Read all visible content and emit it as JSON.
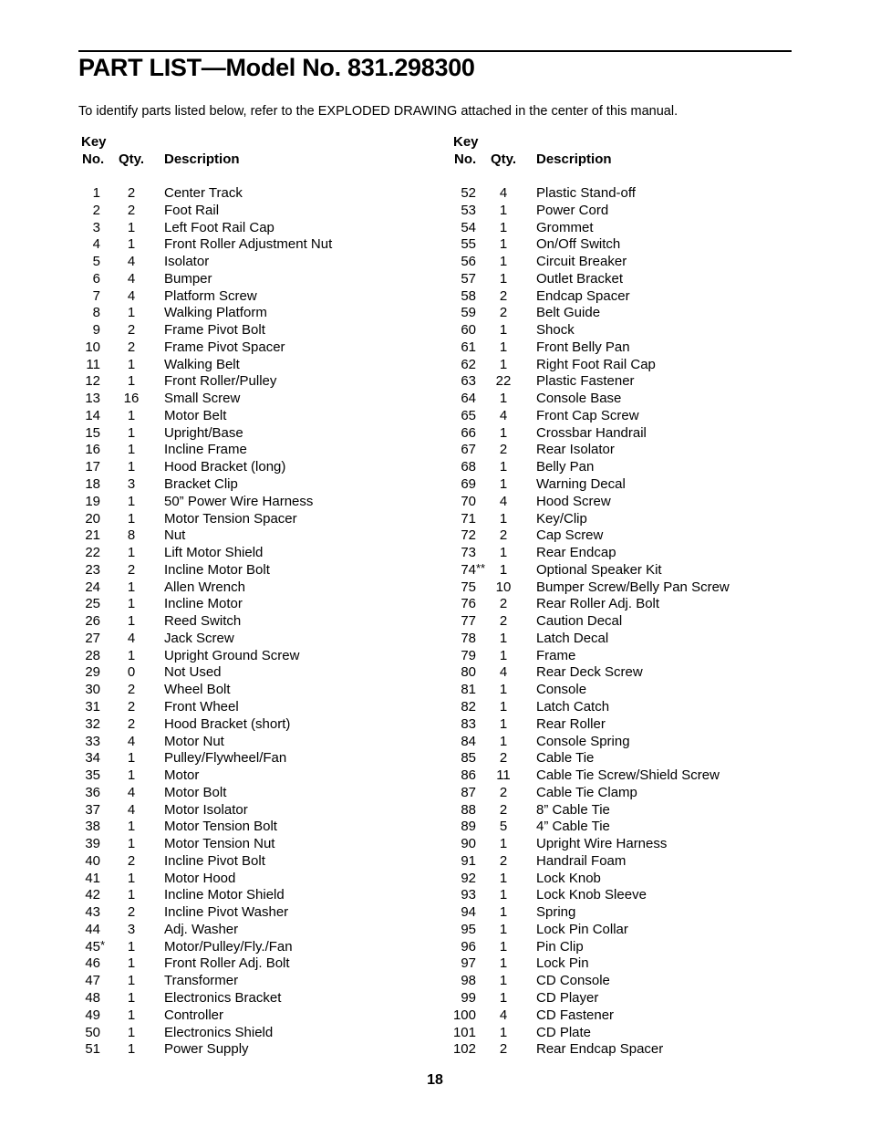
{
  "title": "PART LIST—Model No. 831.298300",
  "intro": "To identify parts listed below, refer to the EXPLODED DRAWING attached in the center of this manual.",
  "headers": {
    "key": "Key",
    "no": "No.",
    "qty": "Qty.",
    "description": "Description"
  },
  "left_parts": [
    {
      "key": "1",
      "mark": "",
      "qty": "2",
      "desc": "Center Track"
    },
    {
      "key": "2",
      "mark": "",
      "qty": "2",
      "desc": "Foot Rail"
    },
    {
      "key": "3",
      "mark": "",
      "qty": "1",
      "desc": "Left Foot Rail Cap"
    },
    {
      "key": "4",
      "mark": "",
      "qty": "1",
      "desc": "Front Roller Adjustment Nut"
    },
    {
      "key": "5",
      "mark": "",
      "qty": "4",
      "desc": "Isolator"
    },
    {
      "key": "6",
      "mark": "",
      "qty": "4",
      "desc": "Bumper"
    },
    {
      "key": "7",
      "mark": "",
      "qty": "4",
      "desc": "Platform Screw"
    },
    {
      "key": "8",
      "mark": "",
      "qty": "1",
      "desc": "Walking Platform"
    },
    {
      "key": "9",
      "mark": "",
      "qty": "2",
      "desc": "Frame Pivot Bolt"
    },
    {
      "key": "10",
      "mark": "",
      "qty": "2",
      "desc": "Frame Pivot Spacer"
    },
    {
      "key": "11",
      "mark": "",
      "qty": "1",
      "desc": "Walking Belt"
    },
    {
      "key": "12",
      "mark": "",
      "qty": "1",
      "desc": "Front Roller/Pulley"
    },
    {
      "key": "13",
      "mark": "",
      "qty": "16",
      "desc": "Small Screw"
    },
    {
      "key": "14",
      "mark": "",
      "qty": "1",
      "desc": "Motor Belt"
    },
    {
      "key": "15",
      "mark": "",
      "qty": "1",
      "desc": "Upright/Base"
    },
    {
      "key": "16",
      "mark": "",
      "qty": "1",
      "desc": "Incline Frame"
    },
    {
      "key": "17",
      "mark": "",
      "qty": "1",
      "desc": "Hood Bracket (long)"
    },
    {
      "key": "18",
      "mark": "",
      "qty": "3",
      "desc": "Bracket Clip"
    },
    {
      "key": "19",
      "mark": "",
      "qty": "1",
      "desc": "50” Power Wire Harness"
    },
    {
      "key": "20",
      "mark": "",
      "qty": "1",
      "desc": "Motor Tension Spacer"
    },
    {
      "key": "21",
      "mark": "",
      "qty": "8",
      "desc": "Nut"
    },
    {
      "key": "22",
      "mark": "",
      "qty": "1",
      "desc": "Lift Motor Shield"
    },
    {
      "key": "23",
      "mark": "",
      "qty": "2",
      "desc": "Incline Motor Bolt"
    },
    {
      "key": "24",
      "mark": "",
      "qty": "1",
      "desc": "Allen Wrench"
    },
    {
      "key": "25",
      "mark": "",
      "qty": "1",
      "desc": "Incline Motor"
    },
    {
      "key": "26",
      "mark": "",
      "qty": "1",
      "desc": "Reed Switch"
    },
    {
      "key": "27",
      "mark": "",
      "qty": "4",
      "desc": "Jack Screw"
    },
    {
      "key": "28",
      "mark": "",
      "qty": "1",
      "desc": "Upright Ground Screw"
    },
    {
      "key": "29",
      "mark": "",
      "qty": "0",
      "desc": "Not Used"
    },
    {
      "key": "30",
      "mark": "",
      "qty": "2",
      "desc": "Wheel Bolt"
    },
    {
      "key": "31",
      "mark": "",
      "qty": "2",
      "desc": "Front Wheel"
    },
    {
      "key": "32",
      "mark": "",
      "qty": "2",
      "desc": "Hood Bracket (short)"
    },
    {
      "key": "33",
      "mark": "",
      "qty": "4",
      "desc": "Motor Nut"
    },
    {
      "key": "34",
      "mark": "",
      "qty": "1",
      "desc": "Pulley/Flywheel/Fan"
    },
    {
      "key": "35",
      "mark": "",
      "qty": "1",
      "desc": "Motor"
    },
    {
      "key": "36",
      "mark": "",
      "qty": "4",
      "desc": "Motor Bolt"
    },
    {
      "key": "37",
      "mark": "",
      "qty": "4",
      "desc": "Motor Isolator"
    },
    {
      "key": "38",
      "mark": "",
      "qty": "1",
      "desc": "Motor Tension Bolt"
    },
    {
      "key": "39",
      "mark": "",
      "qty": "1",
      "desc": "Motor Tension Nut"
    },
    {
      "key": "40",
      "mark": "",
      "qty": "2",
      "desc": "Incline Pivot Bolt"
    },
    {
      "key": "41",
      "mark": "",
      "qty": "1",
      "desc": "Motor Hood"
    },
    {
      "key": "42",
      "mark": "",
      "qty": "1",
      "desc": "Incline Motor Shield"
    },
    {
      "key": "43",
      "mark": "",
      "qty": "2",
      "desc": "Incline Pivot Washer"
    },
    {
      "key": "44",
      "mark": "",
      "qty": "3",
      "desc": "Adj. Washer"
    },
    {
      "key": "45",
      "mark": "*",
      "qty": "1",
      "desc": "Motor/Pulley/Fly./Fan"
    },
    {
      "key": "46",
      "mark": "",
      "qty": "1",
      "desc": "Front Roller Adj. Bolt"
    },
    {
      "key": "47",
      "mark": "",
      "qty": "1",
      "desc": "Transformer"
    },
    {
      "key": "48",
      "mark": "",
      "qty": "1",
      "desc": "Electronics Bracket"
    },
    {
      "key": "49",
      "mark": "",
      "qty": "1",
      "desc": "Controller"
    },
    {
      "key": "50",
      "mark": "",
      "qty": "1",
      "desc": "Electronics Shield"
    },
    {
      "key": "51",
      "mark": "",
      "qty": "1",
      "desc": "Power Supply"
    }
  ],
  "right_parts": [
    {
      "key": "52",
      "mark": "",
      "qty": "4",
      "desc": "Plastic Stand-off"
    },
    {
      "key": "53",
      "mark": "",
      "qty": "1",
      "desc": "Power Cord"
    },
    {
      "key": "54",
      "mark": "",
      "qty": "1",
      "desc": "Grommet"
    },
    {
      "key": "55",
      "mark": "",
      "qty": "1",
      "desc": "On/Off Switch"
    },
    {
      "key": "56",
      "mark": "",
      "qty": "1",
      "desc": "Circuit Breaker"
    },
    {
      "key": "57",
      "mark": "",
      "qty": "1",
      "desc": "Outlet Bracket"
    },
    {
      "key": "58",
      "mark": "",
      "qty": "2",
      "desc": "Endcap Spacer"
    },
    {
      "key": "59",
      "mark": "",
      "qty": "2",
      "desc": "Belt Guide"
    },
    {
      "key": "60",
      "mark": "",
      "qty": "1",
      "desc": "Shock"
    },
    {
      "key": "61",
      "mark": "",
      "qty": "1",
      "desc": "Front Belly Pan"
    },
    {
      "key": "62",
      "mark": "",
      "qty": "1",
      "desc": "Right Foot Rail Cap"
    },
    {
      "key": "63",
      "mark": "",
      "qty": "22",
      "desc": "Plastic Fastener"
    },
    {
      "key": "64",
      "mark": "",
      "qty": "1",
      "desc": "Console Base"
    },
    {
      "key": "65",
      "mark": "",
      "qty": "4",
      "desc": "Front Cap Screw"
    },
    {
      "key": "66",
      "mark": "",
      "qty": "1",
      "desc": "Crossbar Handrail"
    },
    {
      "key": "67",
      "mark": "",
      "qty": "2",
      "desc": "Rear Isolator"
    },
    {
      "key": "68",
      "mark": "",
      "qty": "1",
      "desc": "Belly Pan"
    },
    {
      "key": "69",
      "mark": "",
      "qty": "1",
      "desc": "Warning Decal"
    },
    {
      "key": "70",
      "mark": "",
      "qty": "4",
      "desc": "Hood Screw"
    },
    {
      "key": "71",
      "mark": "",
      "qty": "1",
      "desc": "Key/Clip"
    },
    {
      "key": "72",
      "mark": "",
      "qty": "2",
      "desc": "Cap Screw"
    },
    {
      "key": "73",
      "mark": "",
      "qty": "1",
      "desc": "Rear Endcap"
    },
    {
      "key": "74",
      "mark": "**",
      "qty": "1",
      "desc": "Optional Speaker Kit"
    },
    {
      "key": "75",
      "mark": "",
      "qty": "10",
      "desc": "Bumper Screw/Belly Pan Screw"
    },
    {
      "key": "76",
      "mark": "",
      "qty": "2",
      "desc": "Rear Roller Adj. Bolt"
    },
    {
      "key": "77",
      "mark": "",
      "qty": "2",
      "desc": "Caution Decal"
    },
    {
      "key": "78",
      "mark": "",
      "qty": "1",
      "desc": "Latch Decal"
    },
    {
      "key": "79",
      "mark": "",
      "qty": "1",
      "desc": "Frame"
    },
    {
      "key": "80",
      "mark": "",
      "qty": "4",
      "desc": "Rear Deck Screw"
    },
    {
      "key": "81",
      "mark": "",
      "qty": "1",
      "desc": "Console"
    },
    {
      "key": "82",
      "mark": "",
      "qty": "1",
      "desc": "Latch Catch"
    },
    {
      "key": "83",
      "mark": "",
      "qty": "1",
      "desc": "Rear Roller"
    },
    {
      "key": "84",
      "mark": "",
      "qty": "1",
      "desc": "Console Spring"
    },
    {
      "key": "85",
      "mark": "",
      "qty": "2",
      "desc": "Cable Tie"
    },
    {
      "key": "86",
      "mark": "",
      "qty": "11",
      "desc": "Cable Tie Screw/Shield Screw"
    },
    {
      "key": "87",
      "mark": "",
      "qty": "2",
      "desc": "Cable Tie Clamp"
    },
    {
      "key": "88",
      "mark": "",
      "qty": "2",
      "desc": "8” Cable Tie"
    },
    {
      "key": "89",
      "mark": "",
      "qty": "5",
      "desc": "4” Cable Tie"
    },
    {
      "key": "90",
      "mark": "",
      "qty": "1",
      "desc": "Upright Wire Harness"
    },
    {
      "key": "91",
      "mark": "",
      "qty": "2",
      "desc": "Handrail Foam"
    },
    {
      "key": "92",
      "mark": "",
      "qty": "1",
      "desc": "Lock Knob"
    },
    {
      "key": "93",
      "mark": "",
      "qty": "1",
      "desc": "Lock Knob Sleeve"
    },
    {
      "key": "94",
      "mark": "",
      "qty": "1",
      "desc": "Spring"
    },
    {
      "key": "95",
      "mark": "",
      "qty": "1",
      "desc": "Lock Pin Collar"
    },
    {
      "key": "96",
      "mark": "",
      "qty": "1",
      "desc": "Pin Clip"
    },
    {
      "key": "97",
      "mark": "",
      "qty": "1",
      "desc": "Lock Pin"
    },
    {
      "key": "98",
      "mark": "",
      "qty": "1",
      "desc": "CD Console"
    },
    {
      "key": "99",
      "mark": "",
      "qty": "1",
      "desc": "CD Player"
    },
    {
      "key": "100",
      "mark": "",
      "qty": "4",
      "desc": "CD Fastener"
    },
    {
      "key": "101",
      "mark": "",
      "qty": "1",
      "desc": "CD Plate"
    },
    {
      "key": "102",
      "mark": "",
      "qty": "2",
      "desc": "Rear Endcap Spacer"
    }
  ],
  "page_number": "18"
}
